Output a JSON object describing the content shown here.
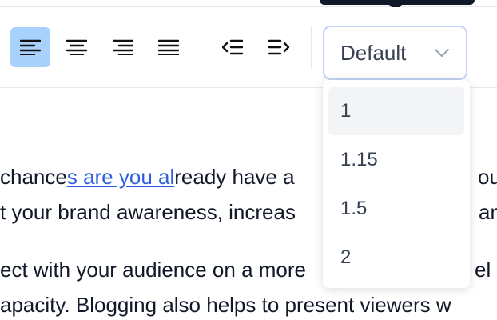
{
  "toolbar": {
    "buttons": [
      {
        "name": "align-left",
        "active": true
      },
      {
        "name": "align-center",
        "active": false
      },
      {
        "name": "align-right",
        "active": false
      },
      {
        "name": "align-justify",
        "active": false
      },
      {
        "name": "outdent",
        "active": false
      },
      {
        "name": "indent",
        "active": false
      }
    ],
    "line_height_select": {
      "value": "Default",
      "options": [
        "1",
        "1.15",
        "1.5",
        "2"
      ],
      "highlighted_option": "1"
    }
  },
  "document": {
    "line1": {
      "before_link": "chance",
      "link": "s are you al",
      "after_link": "ready have a",
      "right_fragment": "ou c"
    },
    "line2": {
      "left": "t your brand awareness, increas",
      "right_fragment": "an"
    },
    "line3": {
      "text": "ect with your audience on a more",
      "right_fragment": "el a"
    },
    "line4": {
      "text": "apacity. Blogging also helps to present viewers w"
    }
  },
  "colors": {
    "accent": "#a8d1fb",
    "link": "#2f5ee0",
    "select_border": "#c3d3f5",
    "highlight": "#f3f4f6",
    "tooltip": "#111827"
  }
}
